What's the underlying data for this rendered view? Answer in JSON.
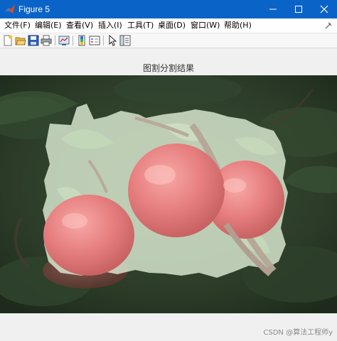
{
  "window": {
    "title": "Figure 5",
    "controls": [
      "minimize",
      "maximize",
      "close"
    ]
  },
  "menu": {
    "items": [
      "文件(F)",
      "编辑(E)",
      "查看(V)",
      "插入(I)",
      "工具(T)",
      "桌面(D)",
      "窗口(W)",
      "帮助(H)"
    ]
  },
  "toolbar": {
    "icons": [
      "new-figure-icon",
      "open-file-icon",
      "save-icon",
      "print-icon",
      "link-plot-icon",
      "insert-colorbar-icon",
      "insert-legend-icon",
      "edit-plot-arrow-icon",
      "property-inspector-icon"
    ]
  },
  "axes": {
    "title": "图割分割结果"
  },
  "image": {
    "description_icon": "segmented-apple-image",
    "colors": {
      "background": "#2b3a2a",
      "apple": "#e67b7b",
      "overlay": "#d8ecd0"
    }
  },
  "watermark": {
    "text": "CSDN @算法工程师y"
  },
  "colors": {
    "titlebar": "#0a64c8",
    "menubar": "#ffffff",
    "toolbar": "#f7f7f7",
    "canvas": "#f0f0f0"
  }
}
